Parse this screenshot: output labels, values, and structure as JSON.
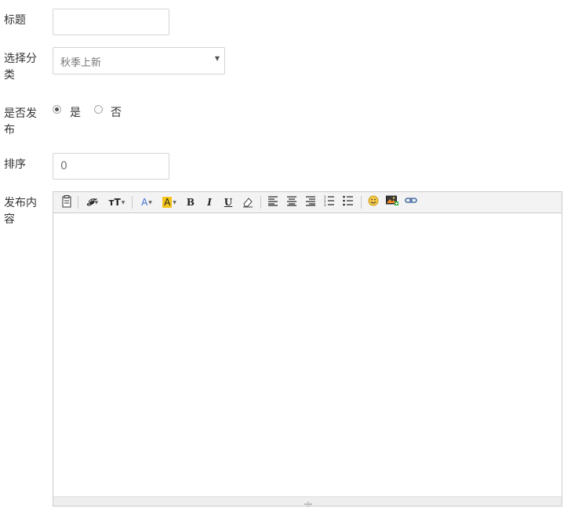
{
  "form": {
    "title_label": "标题",
    "title_value": "",
    "category_label_1": "选择分",
    "category_label_2": "类",
    "category_selected": "秋季上新",
    "publish_label_1": "是否发",
    "publish_label_2": "布",
    "publish_yes": "是",
    "publish_no": "否",
    "publish_selected": "是",
    "sort_label": "排序",
    "sort_placeholder": "0",
    "content_label_1": "发布内",
    "content_label_2": "容"
  },
  "toolbar": {
    "font_glyph": "𝓕",
    "font_size_glyph": "тT",
    "font_color_glyph": "A",
    "highlight_glyph": "A",
    "bold_glyph": "B",
    "italic_glyph": "I",
    "underline_glyph": "U",
    "colors": {
      "font_color": "#3b6fd4",
      "highlight": "#f5c518"
    }
  }
}
